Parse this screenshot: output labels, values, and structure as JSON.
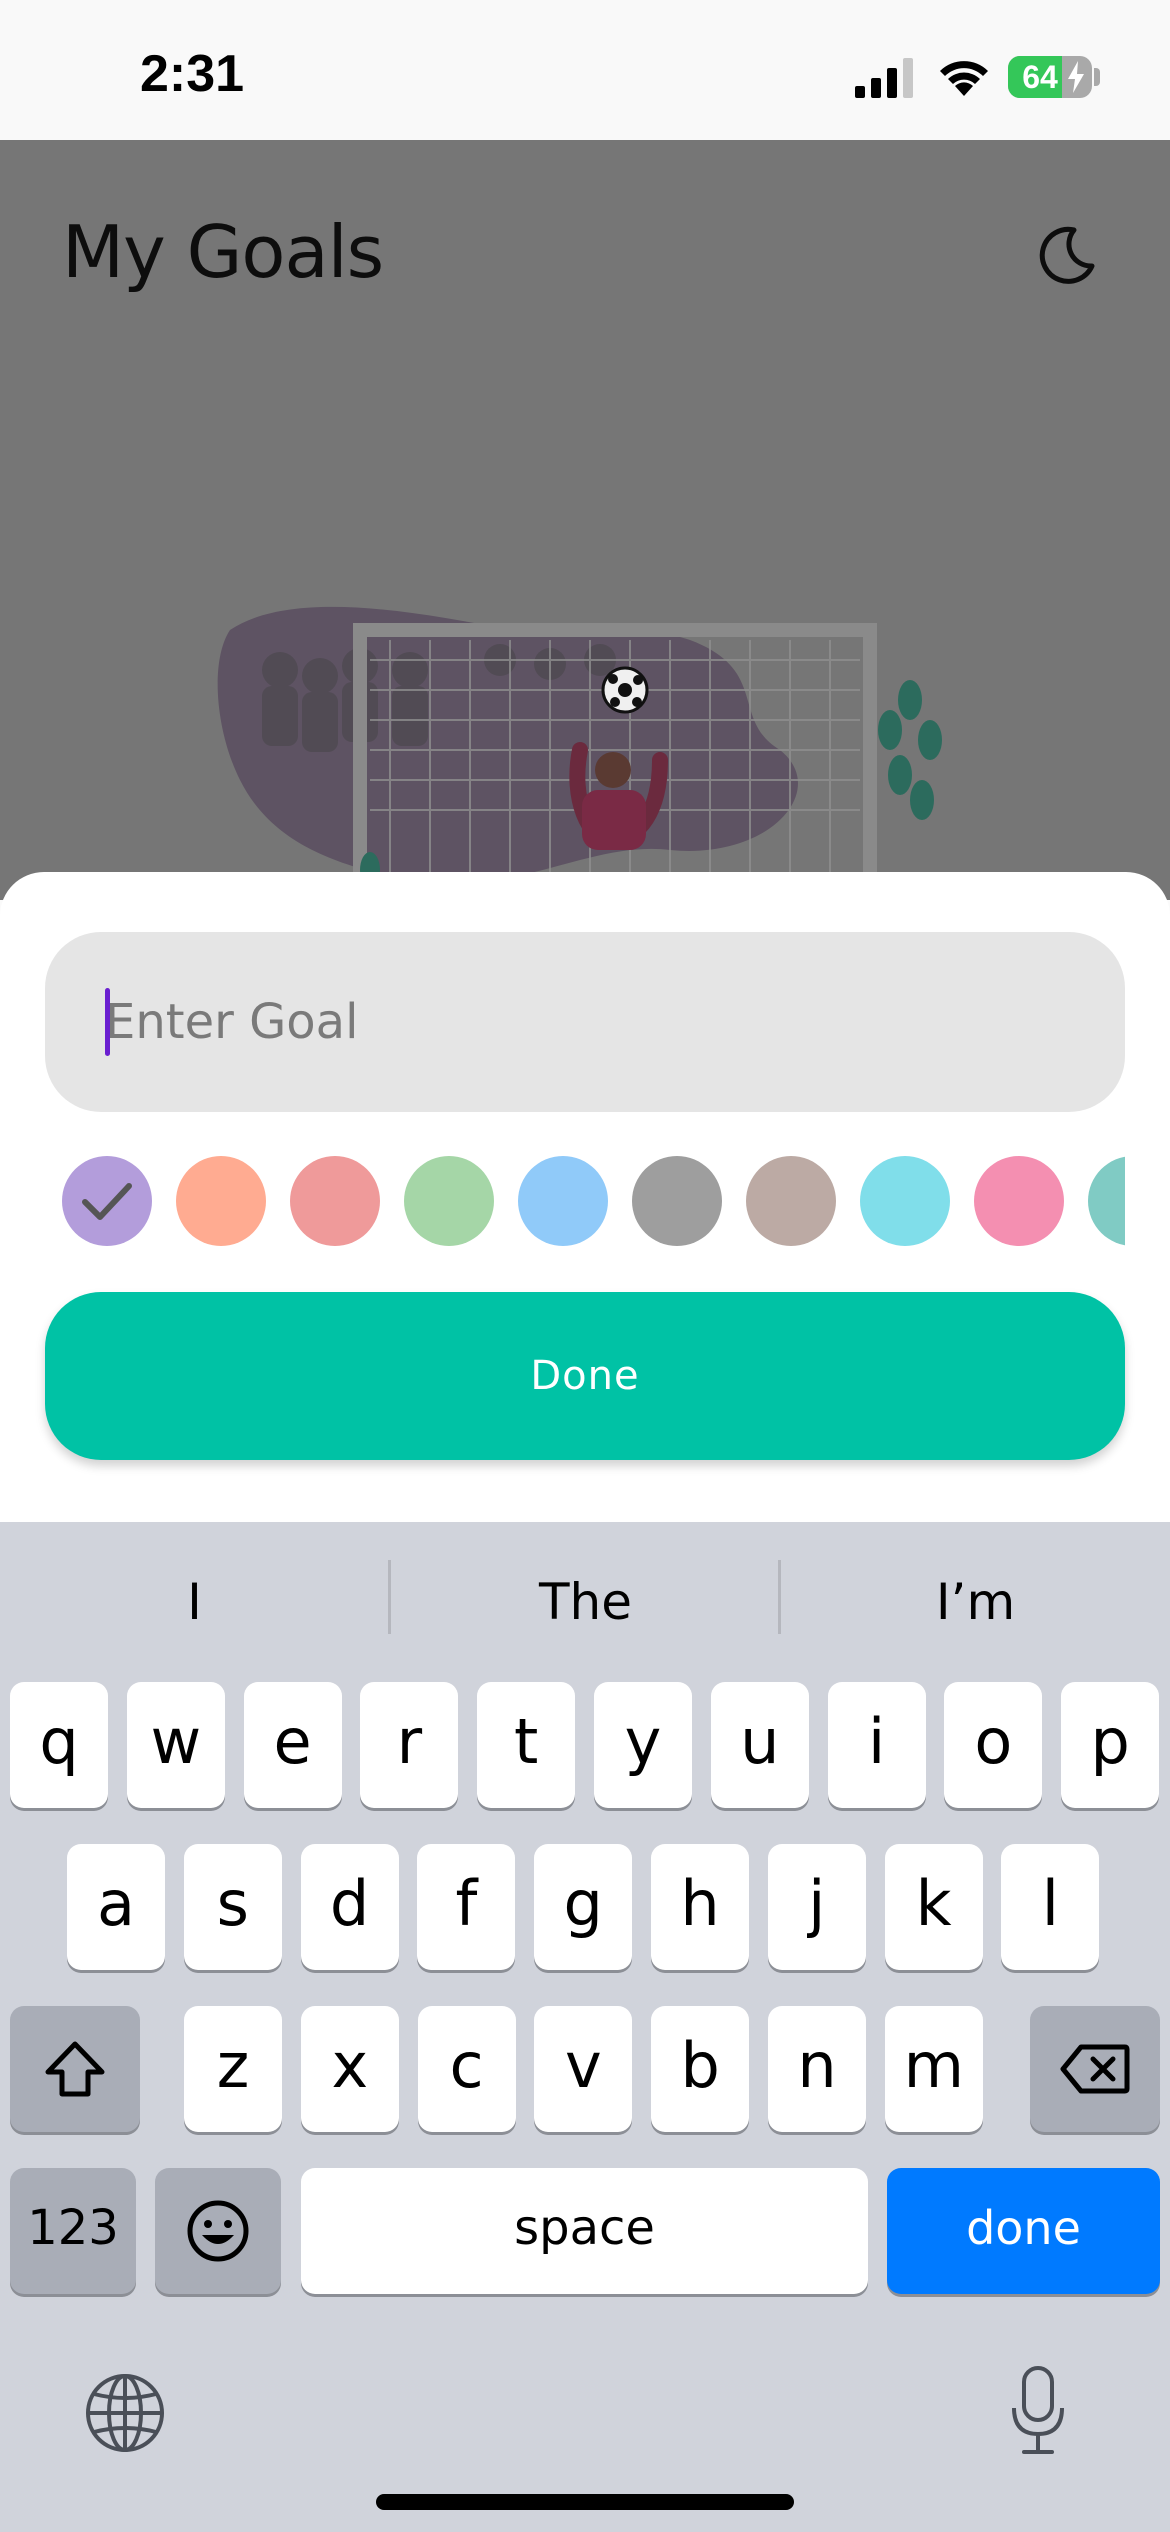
{
  "status_bar": {
    "time": "2:31",
    "battery_percent": "64",
    "battery_level": 0.64
  },
  "header": {
    "title": "My Goals"
  },
  "sheet": {
    "goal_input_placeholder": "Enter Goal",
    "goal_input_value": "",
    "swatches": [
      {
        "name": "purple",
        "color": "#b39ddb",
        "selected": true
      },
      {
        "name": "orange",
        "color": "#ffab91",
        "selected": false
      },
      {
        "name": "red",
        "color": "#ef9a9a",
        "selected": false
      },
      {
        "name": "green",
        "color": "#a5d6a7",
        "selected": false
      },
      {
        "name": "blue",
        "color": "#90caf9",
        "selected": false
      },
      {
        "name": "grey",
        "color": "#9e9e9e",
        "selected": false
      },
      {
        "name": "brown",
        "color": "#bcaaa4",
        "selected": false
      },
      {
        "name": "cyan",
        "color": "#80deea",
        "selected": false
      },
      {
        "name": "pink",
        "color": "#f48fb1",
        "selected": false
      },
      {
        "name": "teal",
        "color": "#80cbc4",
        "selected": false
      }
    ],
    "done_label": "Done"
  },
  "keyboard": {
    "predictions": [
      "I",
      "The",
      "I’m"
    ],
    "row1": [
      "q",
      "w",
      "e",
      "r",
      "t",
      "y",
      "u",
      "i",
      "o",
      "p"
    ],
    "row2": [
      "a",
      "s",
      "d",
      "f",
      "g",
      "h",
      "j",
      "k",
      "l"
    ],
    "row3": [
      "z",
      "x",
      "c",
      "v",
      "b",
      "n",
      "m"
    ],
    "numbers_label": "123",
    "space_label": "space",
    "done_label": "done"
  },
  "colors": {
    "accent": "#00c2a5",
    "keyboard_return": "#007aff",
    "caret": "#6a1fd0"
  }
}
